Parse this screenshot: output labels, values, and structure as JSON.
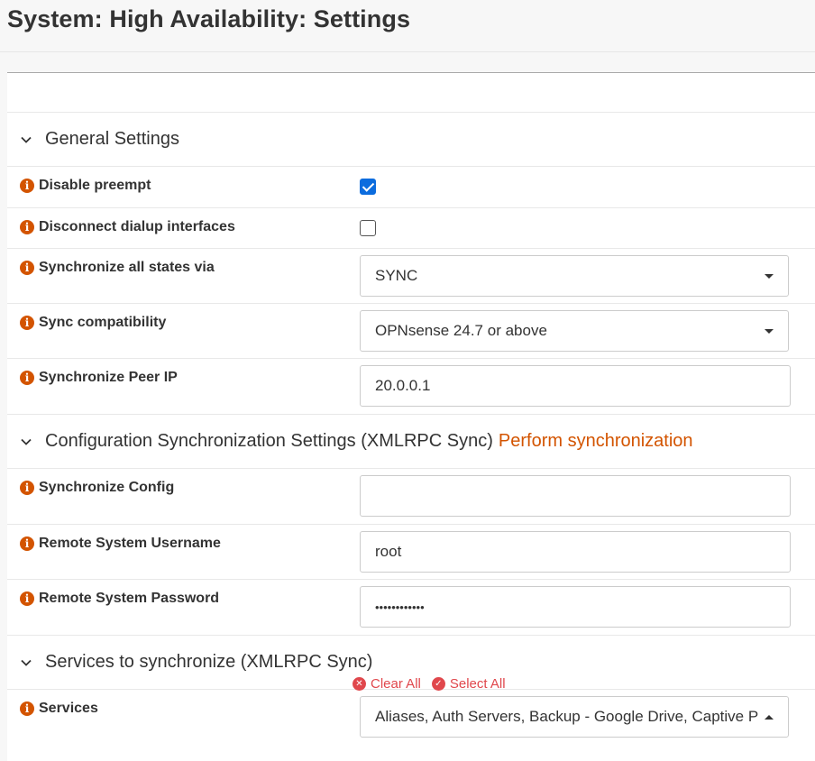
{
  "page": {
    "title": "System: High Availability: Settings"
  },
  "sections": {
    "general": {
      "title": "General Settings",
      "rows": {
        "disable_preempt": {
          "label": "Disable preempt",
          "checked": true
        },
        "disconnect_dialup": {
          "label": "Disconnect dialup interfaces",
          "checked": false
        },
        "sync_states": {
          "label": "Synchronize all states via",
          "value": "SYNC"
        },
        "sync_compat": {
          "label": "Sync compatibility",
          "value": "OPNsense 24.7 or above"
        },
        "peer_ip": {
          "label": "Synchronize Peer IP",
          "value": "20.0.0.1"
        }
      }
    },
    "config_sync": {
      "title": "Configuration Synchronization Settings (XMLRPC Sync)",
      "link": "Perform synchronization",
      "rows": {
        "sync_config": {
          "label": "Synchronize Config",
          "value": ""
        },
        "remote_user": {
          "label": "Remote System Username",
          "value": "root"
        },
        "remote_pass": {
          "label": "Remote System Password",
          "value": "••••••••••••"
        }
      }
    },
    "services": {
      "title": "Services to synchronize (XMLRPC Sync)",
      "rows": {
        "services": {
          "label": "Services",
          "value": "Aliases, Auth Servers, Backup - Google Drive, Captive Portal"
        }
      },
      "clear_all": "Clear All",
      "select_all": "Select All"
    }
  },
  "colors": {
    "accent": "#d35400",
    "checkbox": "#0b6cde",
    "link_red": "#e0474c"
  },
  "icons": {
    "info": "info-circle-icon",
    "chevron": "chevron-down-icon",
    "clear": "times-circle-icon",
    "select": "check-circle-icon"
  }
}
